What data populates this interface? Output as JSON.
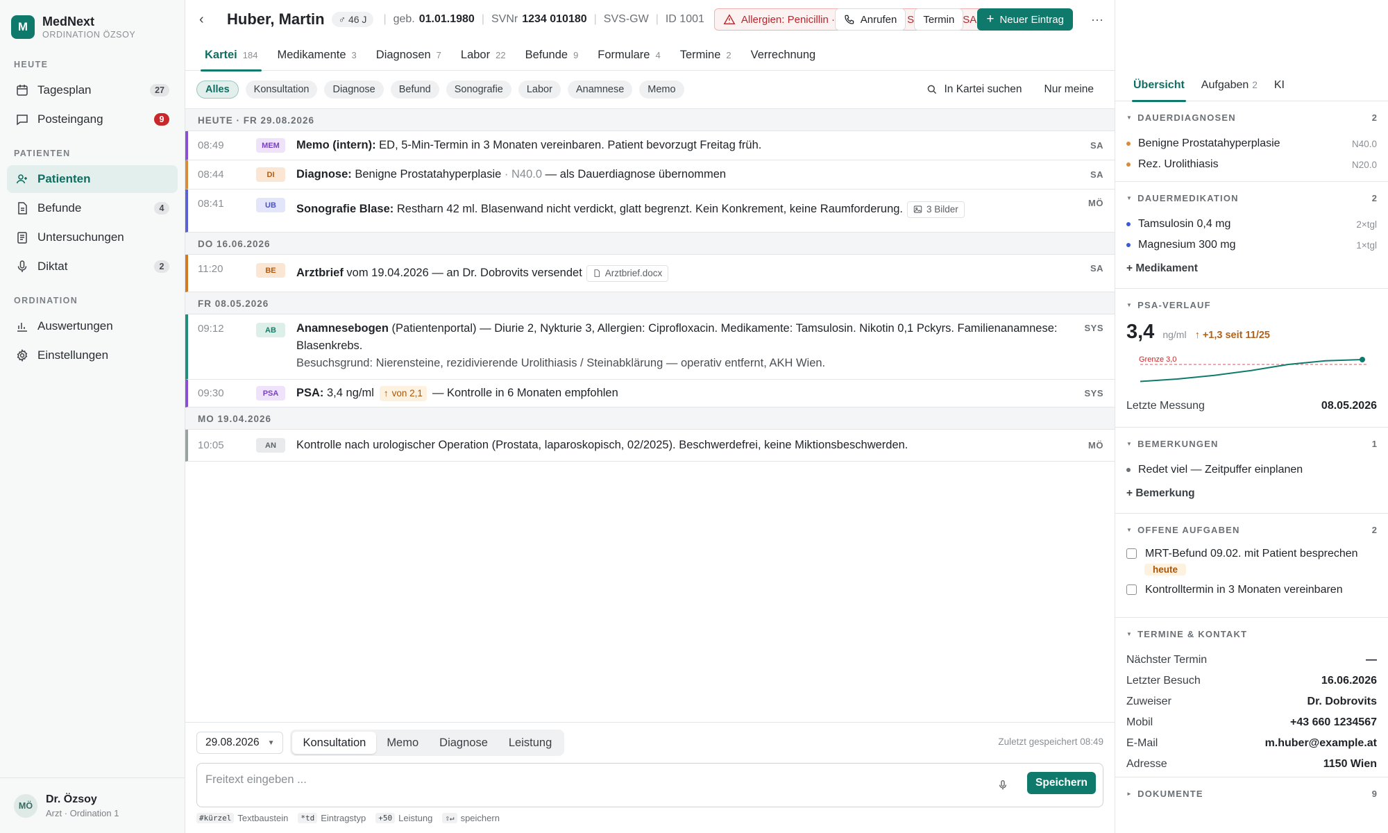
{
  "brand": {
    "name": "MedNext",
    "sub": "ORDINATION ÖZSOY",
    "logo": "M"
  },
  "nav": {
    "sec_today": "HEUTE",
    "sec_patients": "PATIENTEN",
    "sec_ord": "ORDINATION",
    "tagesplan": {
      "label": "Tagesplan",
      "count": "27"
    },
    "posteingang": {
      "label": "Posteingang",
      "count": "9"
    },
    "patienten": {
      "label": "Patienten"
    },
    "befunde": {
      "label": "Befunde",
      "count": "4"
    },
    "untersuchungen": {
      "label": "Untersuchungen"
    },
    "diktat": {
      "label": "Diktat",
      "count": "2"
    },
    "auswertungen": {
      "label": "Auswertungen"
    },
    "einstellungen": {
      "label": "Einstellungen"
    }
  },
  "user": {
    "initials": "MÖ",
    "name": "Dr. Özsoy",
    "role": "Arzt · Ordination 1"
  },
  "patient": {
    "name": "Huber, Martin",
    "age": "♂ 46 J",
    "dob_label": "geb.",
    "dob": "01.01.1980",
    "svnr_label": "SVNr",
    "svnr": "1234 010180",
    "insurer": "SVS-GW",
    "id": "ID 1001",
    "allergies": "Allergien: Penicillin · Ciprofloxacin · Sudafed · NSAR"
  },
  "actions": {
    "call": "Anrufen",
    "appointment": "Termin",
    "new_entry": "Neuer Eintrag",
    "more": "···"
  },
  "tabs": [
    {
      "label": "Kartei",
      "n": "184"
    },
    {
      "label": "Medikamente",
      "n": "3"
    },
    {
      "label": "Diagnosen",
      "n": "7"
    },
    {
      "label": "Labor",
      "n": "22"
    },
    {
      "label": "Befunde",
      "n": "9"
    },
    {
      "label": "Formulare",
      "n": "4"
    },
    {
      "label": "Termine",
      "n": "2"
    },
    {
      "label": "Verrechnung",
      "n": ""
    }
  ],
  "filters": [
    "Alles",
    "Konsultation",
    "Diagnose",
    "Befund",
    "Sonografie",
    "Labor",
    "Anamnese",
    "Memo"
  ],
  "filter_search": "In Kartei suchen",
  "filter_only": "Nur meine",
  "days": [
    "HEUTE · FR 29.08.2026",
    "DO 16.06.2026",
    "FR 08.05.2026",
    "MO 19.04.2026"
  ],
  "entries": {
    "e1": {
      "time": "08:49",
      "tag": "MEM",
      "title": "Memo (intern):",
      "text": " ED, 5-Min-Termin in 3 Monaten vereinbaren. Patient bevorzugt Freitag früh.",
      "who": "SA"
    },
    "e2": {
      "time": "08:44",
      "tag": "DI",
      "title": "Diagnose:",
      "text": " Benigne Prostatahyperplasie",
      "code": " · N40.0",
      "text2": " — als Dauerdiagnose übernommen",
      "who": "SA"
    },
    "e3": {
      "time": "08:41",
      "tag": "UB",
      "title": "Sonografie Blase:",
      "text": " Restharn 42 ml. Blasenwand nicht verdickt, glatt begrenzt. Kein Konkrement, keine Raumforderung.",
      "attach": "3 Bilder",
      "who": "MÖ"
    },
    "e4": {
      "time": "11:20",
      "tag": "BE",
      "title": "Arztbrief",
      "text": " vom 19.04.2026 — an Dr. Dobrovits versendet",
      "attach": "Arztbrief.docx",
      "who": "SA"
    },
    "e5": {
      "time": "09:12",
      "tag": "AB",
      "title": "Anamnesebogen",
      "text": " (Patientenportal) — Diurie 2, Nykturie 3, Allergien: Ciprofloxacin. Medikamente: Tamsulosin. Nikotin 0,1 Pckyrs. Familienanamnese: Blasenkrebs.",
      "text2": "Besuchsgrund: Nierensteine, rezidivierende Urolithiasis / Steinabklärung — operativ entfernt, AKH Wien.",
      "who": "SYS"
    },
    "e6": {
      "time": "09:30",
      "tag": "PSA",
      "title": "PSA:",
      "text": " 3,4 ng/ml",
      "up": "von 2,1",
      "text2": "— Kontrolle in 6 Monaten empfohlen",
      "who": "SYS"
    },
    "e7": {
      "time": "10:05",
      "tag": "AN",
      "text": "Kontrolle nach urologischer Operation (Prostata, laparoskopisch, 02/2025). Beschwerdefrei, keine Miktionsbeschwerden.",
      "who": "MÖ"
    }
  },
  "composer": {
    "date": "29.08.2026",
    "types": [
      "Konsultation",
      "Memo",
      "Diagnose",
      "Leistung"
    ],
    "saved": "Zuletzt gespeichert 08:49",
    "placeholder": "Freitext eingeben ...",
    "save": "Speichern",
    "hints": [
      {
        "k": "#kürzel",
        "t": "Textbaustein"
      },
      {
        "k": "*td",
        "t": "Eintragstyp"
      },
      {
        "k": "+50",
        "t": "Leistung"
      },
      {
        "k": "⇧↵",
        "t": "speichern"
      }
    ]
  },
  "panel": {
    "tabs": {
      "overview": "Übersicht",
      "tasks": "Aufgaben",
      "tasks_n": "2",
      "ai": "KI"
    },
    "dd": {
      "title": "DAUERDIAGNOSEN",
      "count": "2",
      "items": [
        {
          "label": "Benigne Prostatahyperplasie",
          "code": "N40.0"
        },
        {
          "label": "Rez. Urolithiasis",
          "code": "N20.0"
        }
      ]
    },
    "dm": {
      "title": "DAUERMEDIKATION",
      "count": "2",
      "items": [
        {
          "label": "Tamsulosin 0,4 mg",
          "code": "2×tgl"
        },
        {
          "label": "Magnesium 300 mg",
          "code": "1×tgl"
        }
      ],
      "add": "+ Medikament"
    },
    "psa": {
      "title": "PSA-VERLAUF",
      "value": "3,4",
      "unit": "ng/ml",
      "delta": "+1,3 seit 11/25",
      "limit_label": "Grenze 3,0",
      "last_label": "Letzte Messung",
      "last": "08.05.2026"
    },
    "notes": {
      "title": "BEMERKUNGEN",
      "count": "1",
      "items": [
        "Redet viel — Zeitpuffer einplanen"
      ],
      "add": "+ Bemerkung"
    },
    "tasks": {
      "title": "OFFENE AUFGABEN",
      "count": "2",
      "items": [
        {
          "label": "MRT-Befund 09.02. mit Patient besprechen",
          "badge": "heute"
        },
        {
          "label": "Kontrolltermin in 3 Monaten vereinbaren"
        }
      ]
    },
    "contact": {
      "title": "TERMINE & KONTAKT",
      "rows": [
        {
          "k": "Nächster Termin",
          "v": "—"
        },
        {
          "k": "Letzter Besuch",
          "v": "16.06.2026"
        },
        {
          "k": "Zuweiser",
          "v": "Dr. Dobrovits"
        },
        {
          "k": "Mobil",
          "v": "+43 660 1234567"
        },
        {
          "k": "E-Mail",
          "v": "m.huber@example.at"
        },
        {
          "k": "Adresse",
          "v": "1150 Wien"
        }
      ]
    },
    "docs": {
      "title": "DOKUMENTE",
      "count": "9"
    }
  },
  "chart_data": {
    "type": "line",
    "values": [
      1.6,
      1.8,
      2.1,
      2.5,
      3.0,
      3.3,
      3.4
    ],
    "limit": 3.0,
    "ylim": [
      1.0,
      4.2
    ]
  },
  "colors": {
    "accent": "#0f7a6c",
    "alert": "#c8282b"
  }
}
